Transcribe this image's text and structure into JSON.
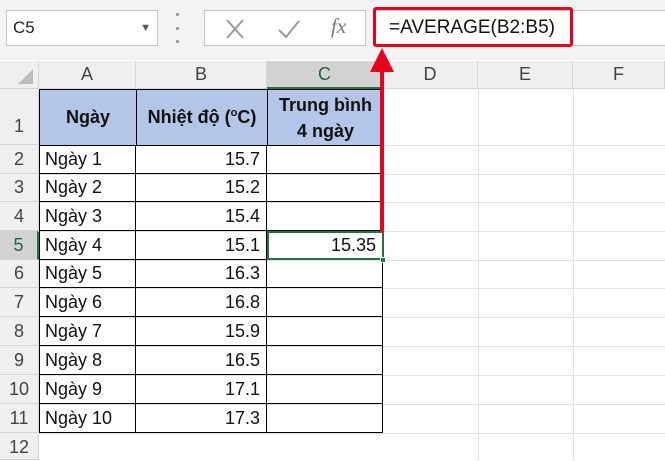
{
  "formula_bar": {
    "name_box": "C5",
    "cancel_icon": "x-icon",
    "enter_icon": "check-icon",
    "function_label": "fx",
    "formula": "=AVERAGE(B2:B5)"
  },
  "columns": [
    "A",
    "B",
    "C",
    "D",
    "E",
    "F"
  ],
  "rows": [
    "1",
    "2",
    "3",
    "4",
    "5",
    "6",
    "7",
    "8",
    "9",
    "10",
    "11",
    "12"
  ],
  "selected": {
    "column": "C",
    "row": "5"
  },
  "table": {
    "headers": {
      "col_a": "Ngày",
      "col_b_main": "Nhiệt độ (",
      "col_b_sup": "o",
      "col_b_end": "C)",
      "col_c_line1": "Trung bình",
      "col_c_line2": "4 ngày"
    },
    "rows": [
      {
        "day": "Ngày 1",
        "temp": "15.7",
        "avg": ""
      },
      {
        "day": "Ngày 2",
        "temp": "15.2",
        "avg": ""
      },
      {
        "day": "Ngày 3",
        "temp": "15.4",
        "avg": ""
      },
      {
        "day": "Ngày 4",
        "temp": "15.1",
        "avg": "15.35"
      },
      {
        "day": "Ngày 5",
        "temp": "16.3",
        "avg": ""
      },
      {
        "day": "Ngày 6",
        "temp": "16.8",
        "avg": ""
      },
      {
        "day": "Ngày 7",
        "temp": "15.9",
        "avg": ""
      },
      {
        "day": "Ngày 8",
        "temp": "16.5",
        "avg": ""
      },
      {
        "day": "Ngày 9",
        "temp": "17.1",
        "avg": ""
      },
      {
        "day": "Ngày 10",
        "temp": "17.3",
        "avg": ""
      }
    ]
  },
  "colors": {
    "header_fill": "#b4c6e7",
    "selection_green": "#217346",
    "annotation_red": "#e8001c"
  }
}
